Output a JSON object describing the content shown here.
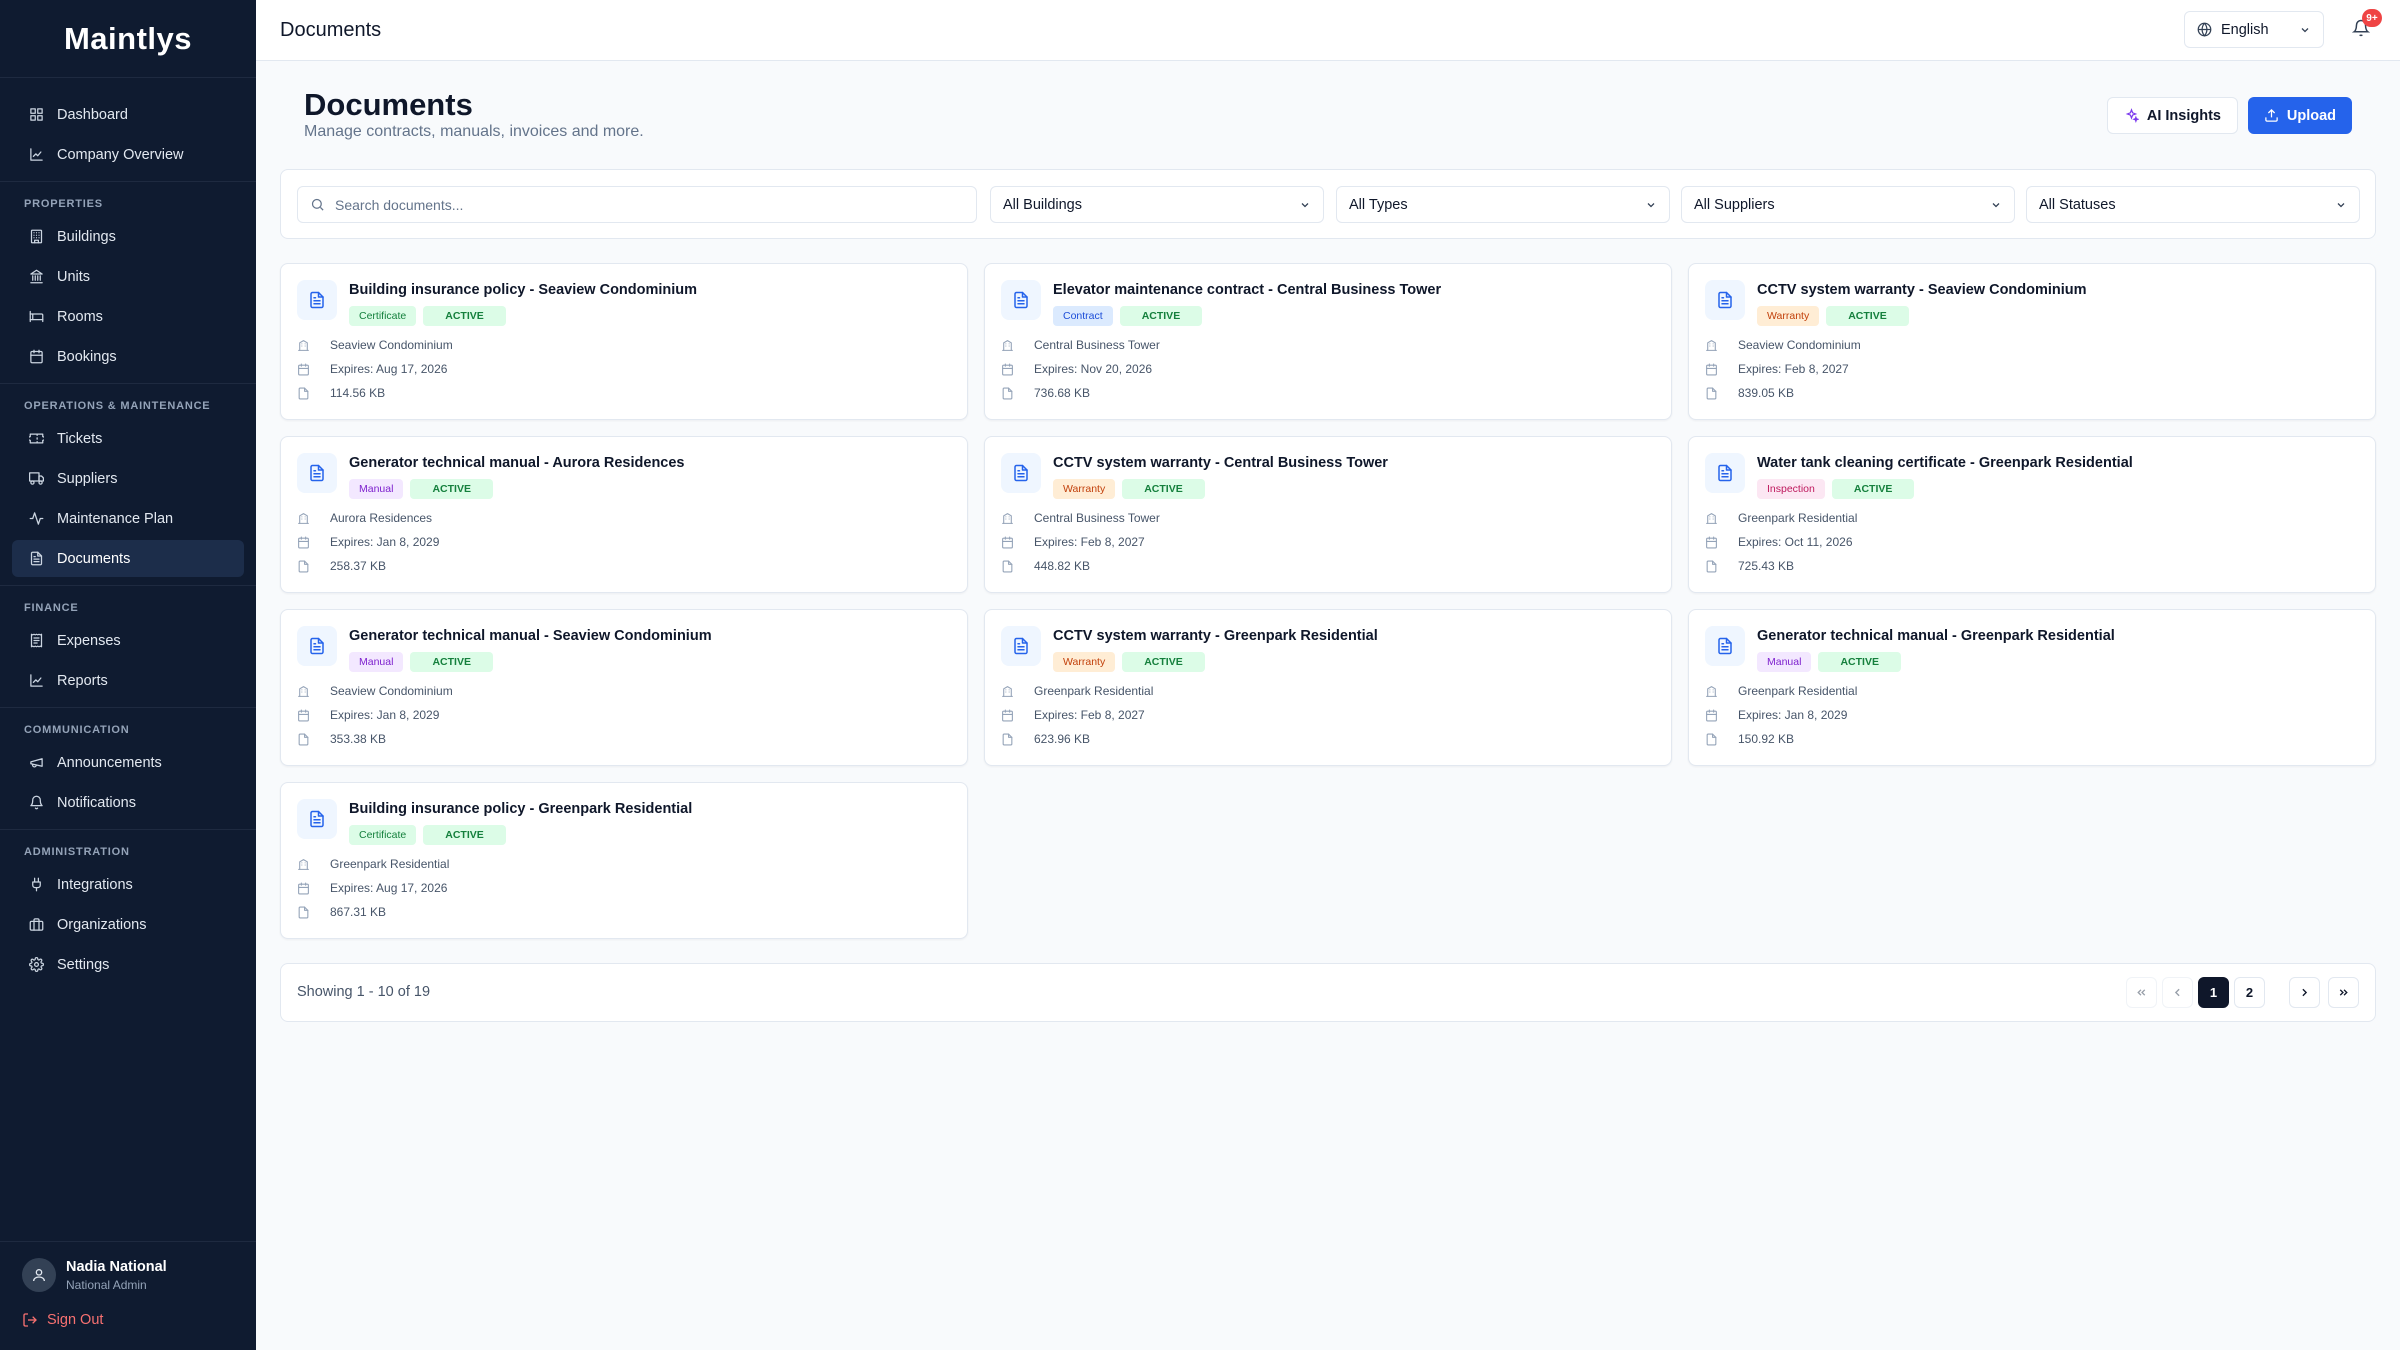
{
  "app": {
    "logo": "Maintlys"
  },
  "sidebar": {
    "top_items": [
      {
        "label": "Dashboard",
        "icon": "dashboard-icon"
      },
      {
        "label": "Company Overview",
        "icon": "chart-icon"
      }
    ],
    "sections": [
      {
        "title": "PROPERTIES",
        "items": [
          {
            "label": "Buildings",
            "icon": "building-icon"
          },
          {
            "label": "Units",
            "icon": "landmark-icon"
          },
          {
            "label": "Rooms",
            "icon": "bed-icon"
          },
          {
            "label": "Bookings",
            "icon": "calendar-icon"
          }
        ]
      },
      {
        "title": "OPERATIONS & MAINTENANCE",
        "items": [
          {
            "label": "Tickets",
            "icon": "ticket-icon"
          },
          {
            "label": "Suppliers",
            "icon": "truck-icon"
          },
          {
            "label": "Maintenance Plan",
            "icon": "activity-icon"
          },
          {
            "label": "Documents",
            "icon": "document-icon",
            "active": true
          }
        ]
      },
      {
        "title": "FINANCE",
        "items": [
          {
            "label": "Expenses",
            "icon": "receipt-icon"
          },
          {
            "label": "Reports",
            "icon": "chart-icon"
          }
        ]
      },
      {
        "title": "COMMUNICATION",
        "items": [
          {
            "label": "Announcements",
            "icon": "megaphone-icon"
          },
          {
            "label": "Notifications",
            "icon": "bell-icon"
          }
        ]
      },
      {
        "title": "ADMINISTRATION",
        "items": [
          {
            "label": "Integrations",
            "icon": "plug-icon"
          },
          {
            "label": "Organizations",
            "icon": "briefcase-icon"
          },
          {
            "label": "Settings",
            "icon": "gear-icon"
          }
        ]
      }
    ],
    "user": {
      "name": "Nadia National",
      "role": "National Admin"
    },
    "sign_out": "Sign Out"
  },
  "header": {
    "title": "Documents",
    "language": "English",
    "notification_badge": "9+"
  },
  "page": {
    "title": "Documents",
    "subtitle": "Manage contracts, manuals, invoices and more.",
    "ai_button": "AI Insights",
    "upload_button": "Upload"
  },
  "filters": {
    "search_placeholder": "Search documents...",
    "buildings": "All Buildings",
    "types": "All Types",
    "suppliers": "All Suppliers",
    "statuses": "All Statuses"
  },
  "tag_colors": {
    "Certificate": {
      "bg": "#dcfce7",
      "fg": "#15803d"
    },
    "Contract": {
      "bg": "#dbeafe",
      "fg": "#1d4ed8"
    },
    "Warranty": {
      "bg": "#ffedd5",
      "fg": "#c2410c"
    },
    "Manual": {
      "bg": "#f3e8ff",
      "fg": "#7e22ce"
    },
    "Inspection": {
      "bg": "#fce7f3",
      "fg": "#be185d"
    }
  },
  "documents": [
    {
      "title": "Building insurance policy - Seaview Condominium",
      "type": "Certificate",
      "status": "ACTIVE",
      "building": "Seaview Condominium",
      "expires": "Expires: Aug 17, 2026",
      "size": "114.56 KB"
    },
    {
      "title": "Elevator maintenance contract - Central Business Tower",
      "type": "Contract",
      "status": "ACTIVE",
      "building": "Central Business Tower",
      "expires": "Expires: Nov 20, 2026",
      "size": "736.68 KB"
    },
    {
      "title": "CCTV system warranty - Seaview Condominium",
      "type": "Warranty",
      "status": "ACTIVE",
      "building": "Seaview Condominium",
      "expires": "Expires: Feb 8, 2027",
      "size": "839.05 KB"
    },
    {
      "title": "Generator technical manual - Aurora Residences",
      "type": "Manual",
      "status": "ACTIVE",
      "building": "Aurora Residences",
      "expires": "Expires: Jan 8, 2029",
      "size": "258.37 KB"
    },
    {
      "title": "CCTV system warranty - Central Business Tower",
      "type": "Warranty",
      "status": "ACTIVE",
      "building": "Central Business Tower",
      "expires": "Expires: Feb 8, 2027",
      "size": "448.82 KB"
    },
    {
      "title": "Water tank cleaning certificate - Greenpark Residential",
      "type": "Inspection",
      "status": "ACTIVE",
      "building": "Greenpark Residential",
      "expires": "Expires: Oct 11, 2026",
      "size": "725.43 KB"
    },
    {
      "title": "Generator technical manual - Seaview Condominium",
      "type": "Manual",
      "status": "ACTIVE",
      "building": "Seaview Condominium",
      "expires": "Expires: Jan 8, 2029",
      "size": "353.38 KB"
    },
    {
      "title": "CCTV system warranty - Greenpark Residential",
      "type": "Warranty",
      "status": "ACTIVE",
      "building": "Greenpark Residential",
      "expires": "Expires: Feb 8, 2027",
      "size": "623.96 KB"
    },
    {
      "title": "Generator technical manual - Greenpark Residential",
      "type": "Manual",
      "status": "ACTIVE",
      "building": "Greenpark Residential",
      "expires": "Expires: Jan 8, 2029",
      "size": "150.92 KB"
    },
    {
      "title": "Building insurance policy - Greenpark Residential",
      "type": "Certificate",
      "status": "ACTIVE",
      "building": "Greenpark Residential",
      "expires": "Expires: Aug 17, 2026",
      "size": "867.31 KB"
    }
  ],
  "pagination": {
    "summary": "Showing 1 - 10 of 19",
    "pages": [
      "1",
      "2"
    ],
    "current": "1"
  }
}
